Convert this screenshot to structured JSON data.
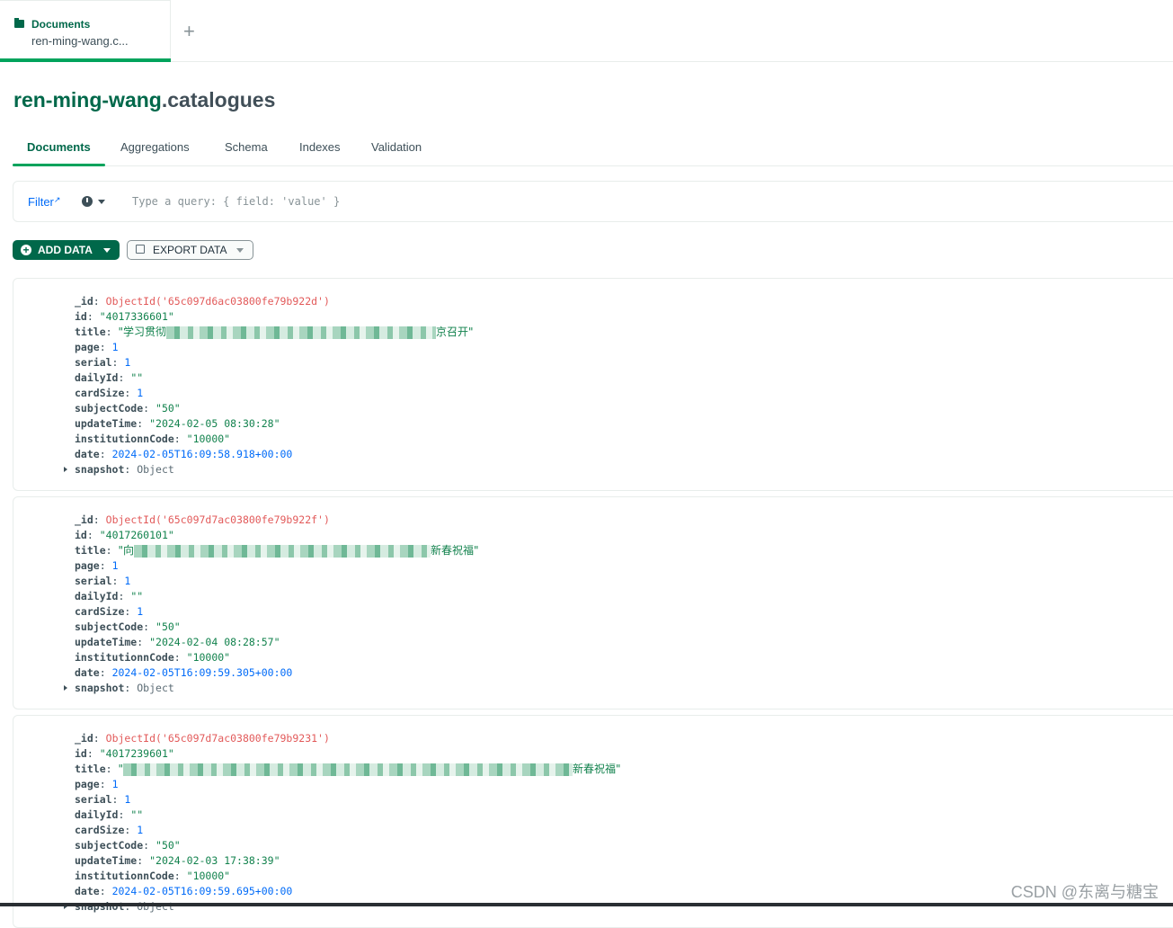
{
  "window_tab": {
    "title": "Documents",
    "subtitle": "ren-ming-wang.c...",
    "icon": "folder-icon",
    "new_tab": "+"
  },
  "header": {
    "db": "ren-ming-wang",
    "collection": ".catalogues"
  },
  "tabs": [
    "Documents",
    "Aggregations",
    "Schema",
    "Indexes",
    "Validation"
  ],
  "filter": {
    "label": "Filter",
    "placeholder": "Type a query: { field: 'value' }"
  },
  "actions": {
    "add": "ADD DATA",
    "export": "EXPORT DATA"
  },
  "documents": [
    {
      "_id": "ObjectId('65c097d6ac03800fe79b922d')",
      "id": "\"4017336601\"",
      "title_start": "\"学习贯彻",
      "title_end": "京召开\"",
      "page": "1",
      "serial": "1",
      "dailyId": "\"\"",
      "cardSize": "1",
      "subjectCode": "\"50\"",
      "updateTime": "\"2024-02-05 08:30:28\"",
      "institutionnCode": "\"10000\"",
      "date": "2024-02-05T16:09:58.918+00:00",
      "snapshot": "Object"
    },
    {
      "_id": "ObjectId('65c097d7ac03800fe79b922f')",
      "id": "\"4017260101\"",
      "title_start": "\"向",
      "title_end": "新春祝福\"",
      "page": "1",
      "serial": "1",
      "dailyId": "\"\"",
      "cardSize": "1",
      "subjectCode": "\"50\"",
      "updateTime": "\"2024-02-04 08:28:57\"",
      "institutionnCode": "\"10000\"",
      "date": "2024-02-05T16:09:59.305+00:00",
      "snapshot": "Object"
    },
    {
      "_id": "ObjectId('65c097d7ac03800fe79b9231')",
      "id": "\"4017239601\"",
      "title_start": "\"",
      "title_end": "新春祝福\"",
      "page": "1",
      "serial": "1",
      "dailyId": "\"\"",
      "cardSize": "1",
      "subjectCode": "\"50\"",
      "updateTime": "\"2024-02-03 17:38:39\"",
      "institutionnCode": "\"10000\"",
      "date": "2024-02-05T16:09:59.695+00:00",
      "snapshot": "Object"
    }
  ],
  "watermark": "CSDN @东离与糖宝"
}
